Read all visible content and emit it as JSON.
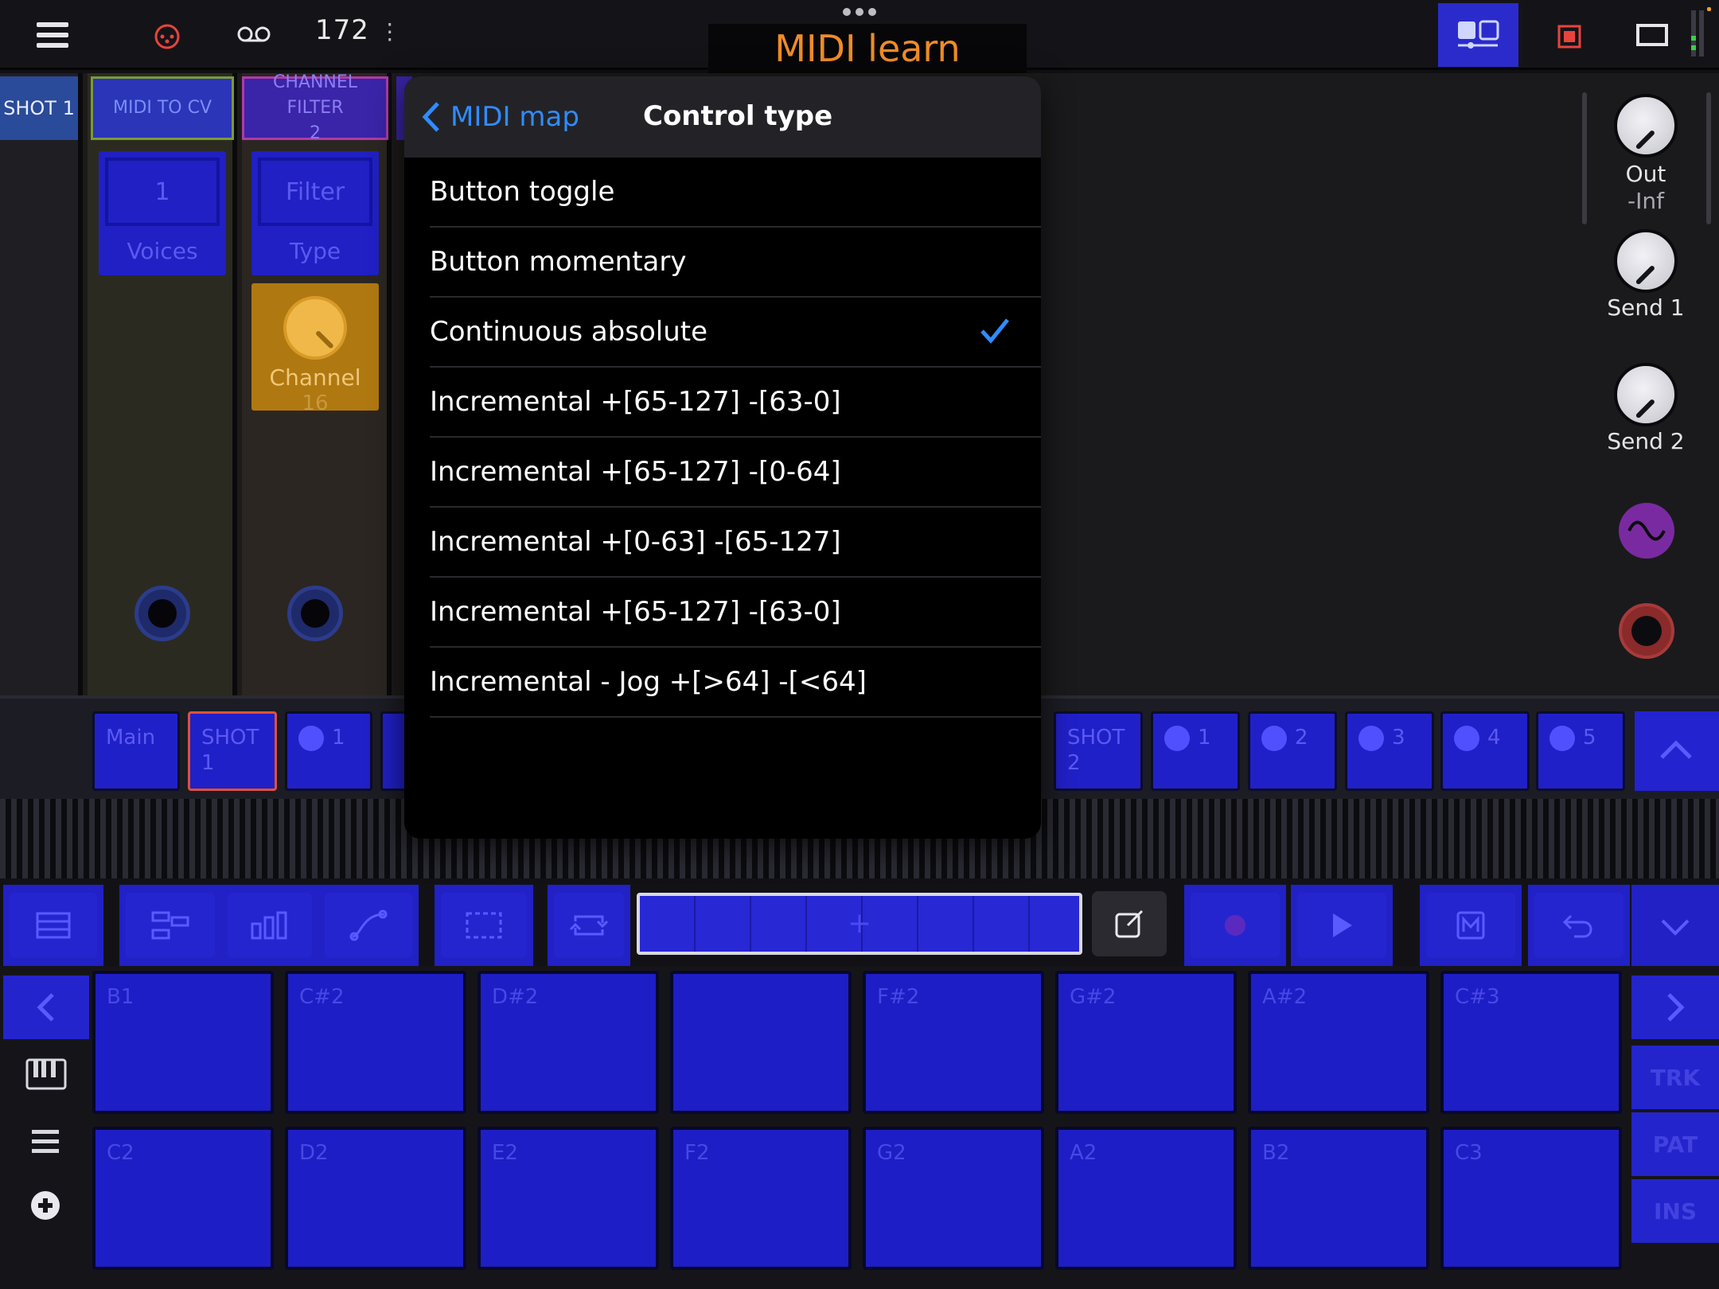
{
  "topbar": {
    "tempo": "172",
    "title": "MIDI learn"
  },
  "rack": {
    "strips": [
      {
        "name": "SHOT  1"
      },
      {
        "name": "MIDI TO CV",
        "control_value": "1",
        "control_label": "Voices"
      },
      {
        "name": "CHANNEL FILTER\n2",
        "control_value": "Filter",
        "control_label": "Type",
        "knob_label": "Channel",
        "knob_value": "16"
      }
    ]
  },
  "mixer": {
    "out_label": "Out",
    "out_value": "-Inf",
    "send1_label": "Send 1",
    "send2_label": "Send 2"
  },
  "popover": {
    "back_label": "MIDI map",
    "title": "Control type",
    "options": [
      "Button toggle",
      "Button momentary",
      "Continuous absolute",
      "Incremental +[65-127] -[63-0]",
      "Incremental +[65-127] -[0-64]",
      "Incremental +[0-63] -[65-127]",
      "Incremental +[65-127] -[63-0]",
      "Incremental - Jog +[>64] -[<64]"
    ],
    "selected": "Continuous absolute"
  },
  "tracks": {
    "main": "Main",
    "shot1": "SHOT\n1",
    "shot1_pad": "1",
    "shot2": "SHOT\n2",
    "shot2_pads": [
      "1",
      "2",
      "3",
      "4",
      "5"
    ]
  },
  "toolbar": {
    "pattern_add": "+"
  },
  "pads": {
    "row1": [
      "B1",
      "C#2",
      "D#2",
      "",
      "F#2",
      "G#2",
      "A#2",
      "C#3"
    ],
    "row2": [
      "C2",
      "D2",
      "E2",
      "F2",
      "G2",
      "A2",
      "B2",
      "C3"
    ]
  },
  "side": {
    "trk": "TRK",
    "pat": "PAT",
    "ins": "INS"
  },
  "colors": {
    "accent_blue": "#2121c6",
    "title_orange": "#f08c28",
    "check_blue": "#2f8cff",
    "shot_red": "#e0503a"
  }
}
